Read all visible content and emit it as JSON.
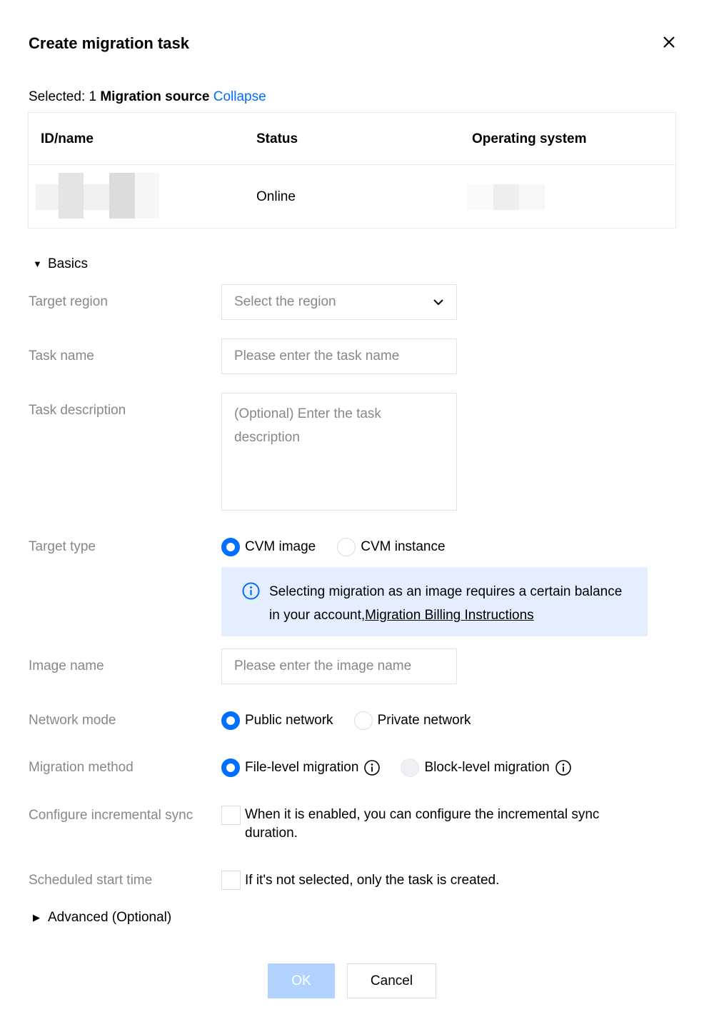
{
  "dialog": {
    "title": "Create migration task",
    "close_icon": "close-icon"
  },
  "selection": {
    "prefix": "Selected: 1",
    "source_label": "Migration source",
    "collapse_label": "Collapse"
  },
  "table": {
    "columns": [
      "ID/name",
      "Status",
      "Operating system"
    ],
    "rows": [
      {
        "status": "Online"
      }
    ]
  },
  "basics": {
    "section_label": "Basics",
    "target_region": {
      "label": "Target region",
      "placeholder": "Select the region"
    },
    "task_name": {
      "label": "Task name",
      "placeholder": "Please enter the task name"
    },
    "task_description": {
      "label": "Task description",
      "placeholder": "(Optional) Enter the task description"
    },
    "target_type": {
      "label": "Target type",
      "options": [
        "CVM image",
        "CVM instance"
      ],
      "selected": "CVM image"
    },
    "notice": {
      "text": "Selecting migration as an image requires a certain balance in your account,",
      "link": "Migration Billing Instructions"
    },
    "image_name": {
      "label": "Image name",
      "placeholder": "Please enter the image name"
    },
    "network_mode": {
      "label": "Network mode",
      "options": [
        "Public network",
        "Private network"
      ],
      "selected": "Public network"
    },
    "migration_method": {
      "label": "Migration method",
      "options": [
        "File-level migration",
        "Block-level migration"
      ],
      "selected": "File-level migration"
    },
    "incremental_sync": {
      "label": "Configure incremental sync",
      "text": "When it is enabled, you can configure the incremental sync duration."
    },
    "scheduled_start": {
      "label": "Scheduled start time",
      "text": "If it's not selected, only the task is created."
    }
  },
  "advanced": {
    "section_label": "Advanced (Optional)"
  },
  "footer": {
    "ok_label": "OK",
    "cancel_label": "Cancel"
  },
  "colors": {
    "accent": "#006eff",
    "notice_bg": "#e4eeff",
    "ok_disabled_bg": "#b2d3ff",
    "label_gray": "#888888"
  }
}
